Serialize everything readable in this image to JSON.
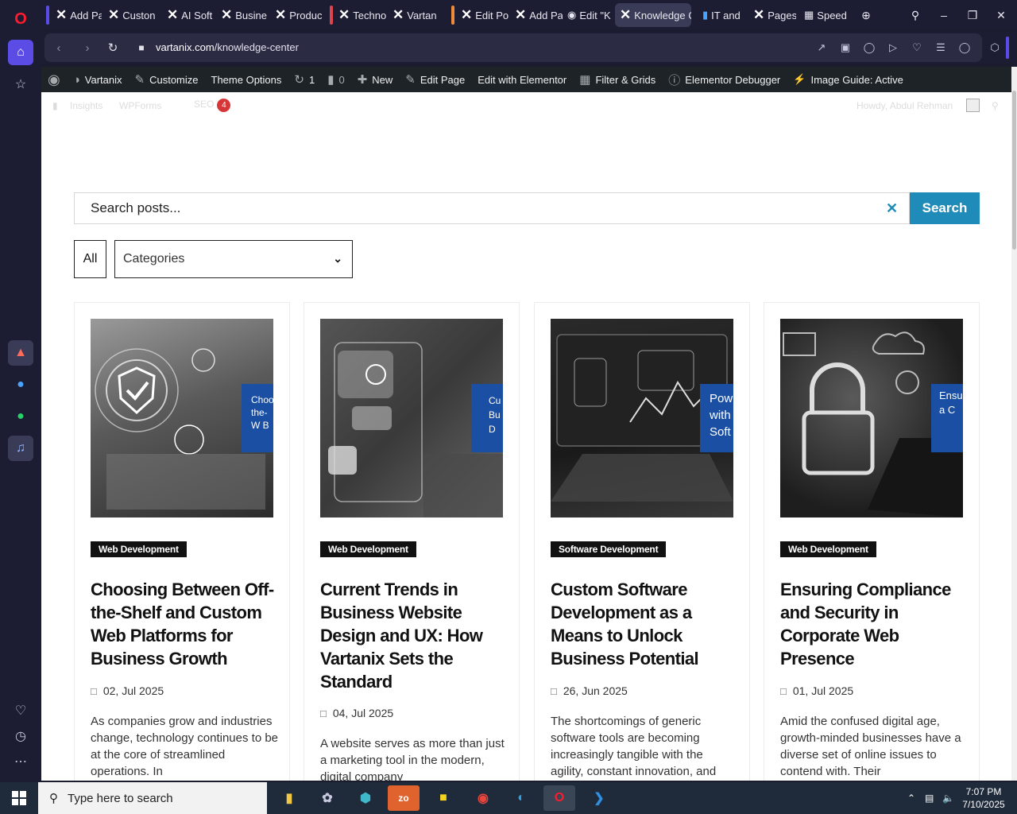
{
  "browser": {
    "tabs": [
      {
        "label": "Add Pa"
      },
      {
        "label": "Custon"
      },
      {
        "label": "AI Soft"
      },
      {
        "label": "Busine"
      },
      {
        "label": "Produc"
      },
      {
        "label": "Techno"
      },
      {
        "label": "Vartan"
      },
      {
        "label": "Edit Po"
      },
      {
        "label": "Add Pa"
      },
      {
        "label": "Edit \"K"
      },
      {
        "label": "Knowledge C"
      },
      {
        "label": "IT and"
      },
      {
        "label": "Pages"
      },
      {
        "label": "Speed"
      }
    ],
    "url_host": "vartanix.com",
    "url_path": "/knowledge-center"
  },
  "adminbar": {
    "site_name": "Vartanix",
    "customize": "Customize",
    "theme_options": "Theme Options",
    "updates_count": "1",
    "comments_count": "0",
    "new": "New",
    "edit_page": "Edit Page",
    "edit_elementor": "Edit with Elementor",
    "filter_grids": "Filter & Grids",
    "elementor_debugger": "Elementor Debugger",
    "image_guide": "Image Guide: Active"
  },
  "ghostbar": {
    "insights": "Insights",
    "wpforms": "WPForms",
    "seo": "SEO",
    "seo_count": "4",
    "howdy": "Howdy, Abdul Rehman"
  },
  "search": {
    "placeholder": "Search posts...",
    "button": "Search"
  },
  "filters": {
    "all": "All",
    "categories": "Categories"
  },
  "posts": [
    {
      "category": "Web Development",
      "title": "Choosing Between Off-the-Shelf and Custom Web Platforms for Business Growth",
      "date": "02, Jul 2025",
      "excerpt": "As companies grow and industries change, technology continues to be at the core of streamlined operations. In",
      "overlay": "Choo the- W B"
    },
    {
      "category": "Web Development",
      "title": "Current Trends in Business Website Design and UX: How Vartanix Sets the Standard",
      "date": "04, Jul 2025",
      "excerpt": "A website serves as more than just a marketing tool in the modern, digital company",
      "overlay": "Cu Bu D"
    },
    {
      "category": "Software Development",
      "title": "Custom Software Development as a Means to Unlock Business Potential",
      "date": "26, Jun 2025",
      "excerpt": "The shortcomings of generic software tools are becoming increasingly tangible with the agility, constant innovation, and",
      "overlay": "Pow with Soft"
    },
    {
      "category": "Web Development",
      "title": "Ensuring Compliance and Security in Corporate Web Presence",
      "date": "01, Jul 2025",
      "excerpt": "Amid the confused digital age, growth-minded businesses have a diverse set of online issues to contend with. Their",
      "overlay": "Ensu a C"
    }
  ],
  "taskbar": {
    "search_placeholder": "Type here to search",
    "time": "7:07 PM",
    "date": "7/10/2025"
  },
  "colors": {
    "accent": "#1f8bb8",
    "adminbar": "#1d2327",
    "browser_bg": "#1c1d33"
  }
}
